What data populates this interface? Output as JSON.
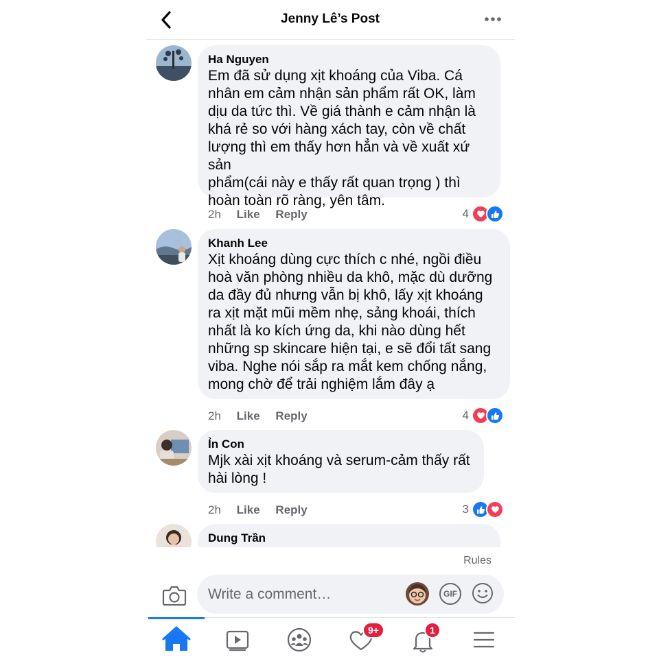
{
  "header": {
    "title": "Jenny Lê’s Post"
  },
  "comments": [
    {
      "author": "Ha Nguyen",
      "lines": [
        "Em đã sử dụng xịt khoáng của Viba. Cá",
        "nhân em cảm nhận sản phẩm rất OK, làm",
        "dịu da tức thì. Về giá thành e cảm nhận là",
        "khá rẻ so với hàng xách tay, còn về chất",
        "lượng thì em thấy hơn hẳn và về xuất xứ sản",
        "phẩm(cái này e thấy rất quan trọng ) thì",
        "hoàn toàn rõ ràng, yên tâm."
      ],
      "time": "2h",
      "like": "Like",
      "reply": "Reply",
      "reaction_count": "4"
    },
    {
      "author": "Khanh Lee",
      "lines": [
        "Xịt khoáng dùng cực thích c nhé, ngồi điều",
        "hoà văn phòng nhiều da khô, mặc dù dưỡng",
        "da đầy đủ nhưng vẫn bị khô, lấy xịt khoáng",
        "ra xịt mặt mũi mềm nhẹ, sảng khoái, thích",
        "nhất là ko kích ứng da, khi nào dùng hết",
        "những sp skincare hiện tại, e sẽ đổi tất sang",
        "viba. Nghe nói sắp ra mắt kem chống nắng,",
        "mong chờ để trải nghiệm lắm đây ạ"
      ],
      "time": "2h",
      "like": "Like",
      "reply": "Reply",
      "reaction_count": "4"
    },
    {
      "author": "Ỉn Con",
      "lines": [
        "Mjk xài xịt khoáng và serum-cảm thấy rất",
        "hài lòng !"
      ],
      "time": "2h",
      "like": "Like",
      "reply": "Reply",
      "reaction_count": "3"
    },
    {
      "author": "Dung Trần",
      "lines": []
    }
  ],
  "rules_label": "Rules",
  "composer": {
    "placeholder": "Write a comment…",
    "gif_label": "GIF"
  },
  "nav": {
    "watch_badge": "",
    "dating_badge": "9+",
    "notifications_badge": "1"
  },
  "colors": {
    "accent": "#1877f2",
    "love": "#f33e58",
    "badge": "#e41e3f"
  }
}
